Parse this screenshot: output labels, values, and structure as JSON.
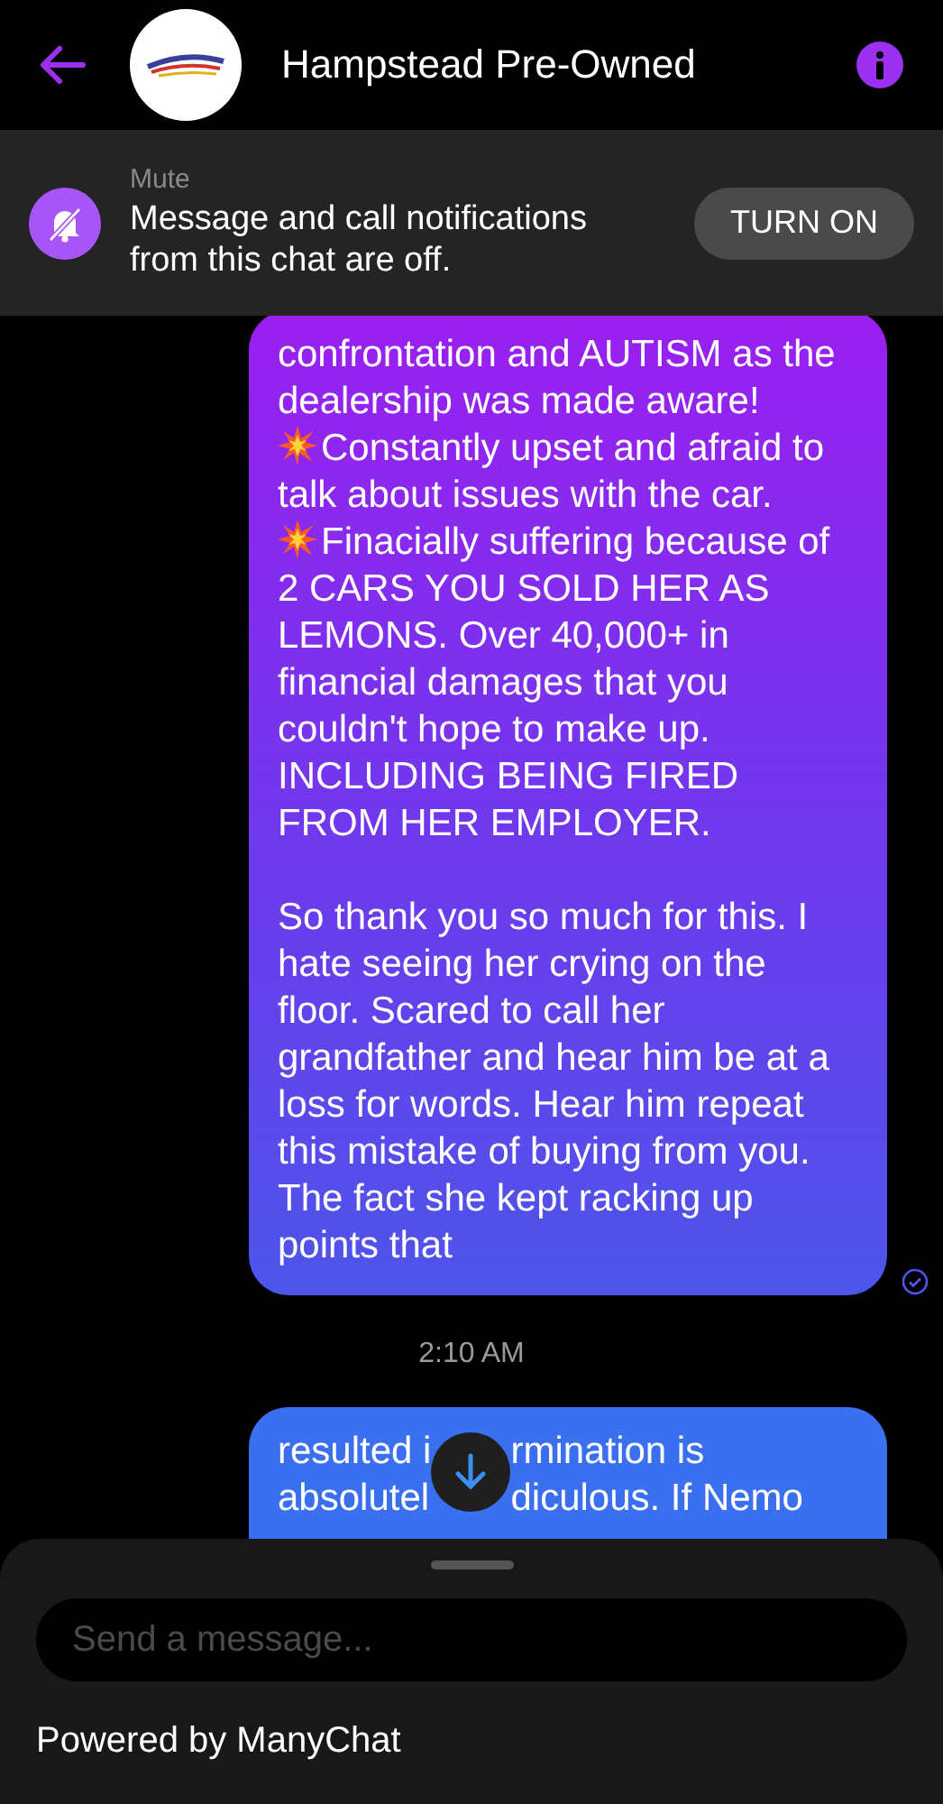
{
  "header": {
    "title": "Hampstead Pre-Owned"
  },
  "mute_banner": {
    "label": "Mute",
    "message": "Message and call notifications from this chat are off.",
    "button": "TURN ON"
  },
  "messages": [
    {
      "kind": "sent",
      "seen": true,
      "paragraphs": [
        {
          "kind": "text",
          "text": "confrontation and AUTISM as the dealership was made aware!"
        },
        {
          "kind": "burst",
          "text": "Constantly upset and afraid to talk about issues with the car."
        },
        {
          "kind": "burst",
          "text": "Finacially suffering because of 2 CARS YOU SOLD HER AS LEMONS. Over 40,000+ in financial damages that you couldn't hope to make up. INCLUDING BEING FIRED FROM HER EMPLOYER."
        },
        {
          "kind": "gap"
        },
        {
          "kind": "text",
          "text": "So thank you so much for this. I hate seeing her crying on the floor. Scared to call her grandfather and hear him be at a loss for words. Hear him repeat this mistake of buying from you. The fact she kept racking up points that"
        }
      ]
    },
    {
      "kind": "time",
      "text": "2:10 AM"
    },
    {
      "kind": "sent",
      "paragraphs": [
        {
          "kind": "split",
          "lines": [
            [
              "resulted i",
              "rmination is"
            ],
            [
              "absolutel",
              "diculous. If Nemo"
            ]
          ]
        }
      ]
    }
  ],
  "composer": {
    "placeholder": "Send a message...",
    "footer": "Powered by ManyChat"
  }
}
